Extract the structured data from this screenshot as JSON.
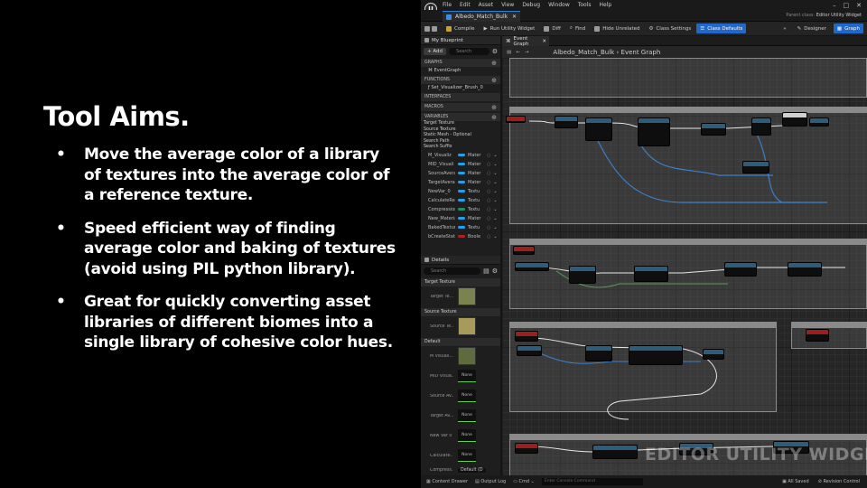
{
  "slide": {
    "title": "Tool Aims.",
    "bullets": [
      "Move the average color of a library of textures into the average color of a reference texture.",
      "Speed efficient way of finding average color and baking of textures (avoid using PIL python library).",
      "Great for quickly converting asset libraries of different biomes into a single library of cohesive color hues."
    ]
  },
  "editor": {
    "logo": "U",
    "menu": [
      "File",
      "Edit",
      "Asset",
      "View",
      "Debug",
      "Window",
      "Tools",
      "Help"
    ],
    "window_controls": [
      "–",
      "□",
      "✕"
    ],
    "asset_tab": "Albedo_Match_Bulk",
    "parent_class_label": "Parent class:",
    "parent_class_value": "Editor Utility Widget",
    "toolbar": {
      "compile": "Compile",
      "run": "Run Utility Widget",
      "diff": "Diff",
      "find": "Find",
      "hide_unrelated": "Hide Unrelated",
      "class_settings": "Class Settings",
      "class_defaults": "Class Defaults",
      "designer": "Designer",
      "graph": "Graph"
    },
    "my_blueprint": {
      "tab": "My Blueprint",
      "add": "+ Add",
      "search_placeholder": "Search",
      "sections": {
        "graphs": "GRAPHS",
        "functions": "FUNCTIONS",
        "interfaces": "INTERFACES",
        "macros": "MACROS",
        "variables": "VARIABLES"
      },
      "event_graph": "EventGraph",
      "function": "Set_Visualizer_Brush_0",
      "categories": [
        "Target Texture",
        "Source Texture",
        "Static Mesh - Optional",
        "Search Path",
        "Search Suffix"
      ],
      "variables": [
        {
          "name": "M_Visualiz",
          "type": "Mater",
          "color": "#22a0e8"
        },
        {
          "name": "MID_Visuali",
          "type": "Mater",
          "color": "#22a0e8"
        },
        {
          "name": "SourceAvera",
          "type": "Mater",
          "color": "#22a0e8"
        },
        {
          "name": "TargetAvera",
          "type": "Mater",
          "color": "#22a0e8"
        },
        {
          "name": "NewVar_0",
          "type": "Textu",
          "color": "#22a0e8"
        },
        {
          "name": "CalculateRes",
          "type": "Textu",
          "color": "#22a0e8"
        },
        {
          "name": "Compression",
          "type": "Textu",
          "color": "#1d8f6a"
        },
        {
          "name": "New_Material",
          "type": "Mater",
          "color": "#22a0e8"
        },
        {
          "name": "BakedTexture",
          "type": "Textu",
          "color": "#22a0e8"
        },
        {
          "name": "bCreateStatic",
          "type": "Boole",
          "color": "#b02020"
        }
      ]
    },
    "details": {
      "tab": "Details",
      "search_placeholder": "Search",
      "sections": [
        "Target Texture",
        "Source Texture",
        "Default"
      ],
      "rows": [
        {
          "label": "Target Te...",
          "kind": "thumb"
        },
        {
          "label": "Source Te...",
          "kind": "thumb"
        },
        {
          "label": "M Visuali...",
          "kind": "thumb"
        },
        {
          "label": "MID Visua...",
          "kind": "none",
          "value": "None"
        },
        {
          "label": "Source Av...",
          "kind": "none",
          "value": "None"
        },
        {
          "label": "Target Av...",
          "kind": "none",
          "value": "None"
        },
        {
          "label": "New Var 0",
          "kind": "none",
          "value": "None"
        },
        {
          "label": "Calculate...",
          "kind": "none",
          "value": "None"
        }
      ],
      "compression_label": "Compress...",
      "compression_value": "Default (D"
    },
    "graph": {
      "tab": "Event Graph",
      "breadcrumb_root": "Albedo_Match_Bulk",
      "breadcrumb_sep": "›",
      "breadcrumb_leaf": "Event Graph",
      "watermark": "EDITOR UTILITY WIDGET"
    },
    "status": {
      "content_drawer": "Content Drawer",
      "output_log": "Output Log",
      "cmd": "Cmd",
      "console_placeholder": "Enter Console Command",
      "all_saved": "All Saved",
      "revision_control": "Revision Control"
    }
  }
}
